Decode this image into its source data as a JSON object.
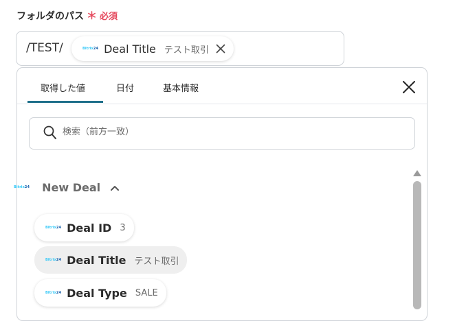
{
  "field": {
    "label": "フォルダのパス",
    "required_mark": "＊",
    "required_text": "必須"
  },
  "path_input": {
    "prefix": "/TEST/",
    "chip": {
      "logo": [
        "Bitrix",
        "24"
      ],
      "title": "Deal Title",
      "subtitle": "テスト取引"
    }
  },
  "tabs": [
    {
      "label": "取得した値",
      "active": true
    },
    {
      "label": "日付",
      "active": false
    },
    {
      "label": "基本情報",
      "active": false
    }
  ],
  "search": {
    "placeholder": "検索（前方一致）"
  },
  "group": {
    "logo": [
      "Bitrix",
      "24"
    ],
    "title": "New Deal",
    "expanded": true,
    "items": [
      {
        "logo": [
          "Bitrix",
          "24"
        ],
        "title": "Deal ID",
        "value": "3"
      },
      {
        "logo": [
          "Bitrix",
          "24"
        ],
        "title": "Deal Title",
        "value": "テスト取引",
        "selected": true
      },
      {
        "logo": [
          "Bitrix",
          "24"
        ],
        "title": "Deal Type",
        "value": "SALE"
      }
    ]
  },
  "colors": {
    "accent": "#1e6f8a",
    "required": "#e5495d",
    "bitrix_light": "#2fc7f7",
    "bitrix_dark": "#0f5aa8"
  },
  "icons": [
    "close-icon",
    "search-icon",
    "chevron-up-icon",
    "scroll-up-arrow-icon",
    "bitrix24-logo"
  ]
}
